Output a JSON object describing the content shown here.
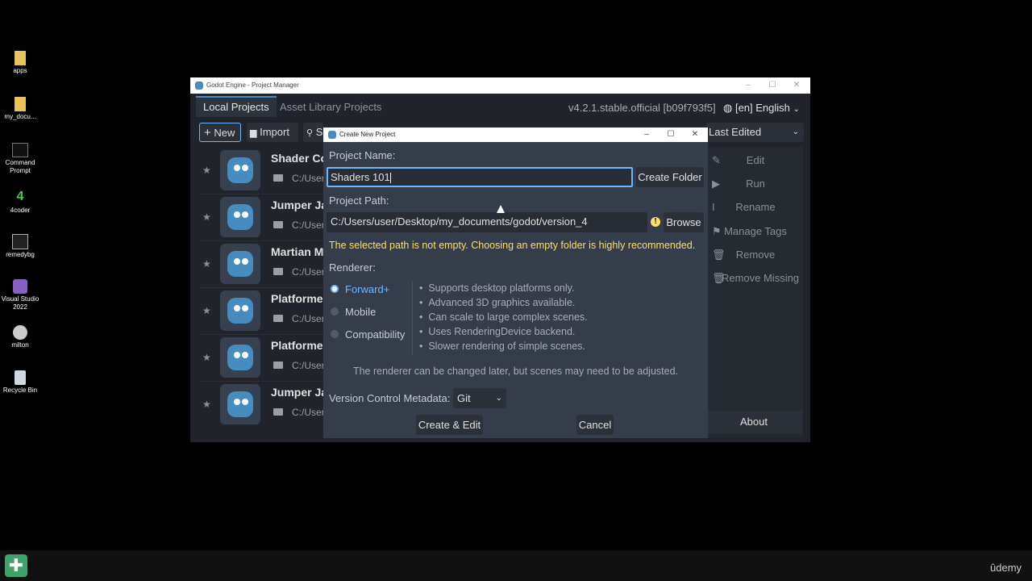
{
  "desktop": {
    "icons": [
      {
        "label": "apps",
        "icon": "folder-icon"
      },
      {
        "label": "my_docu...",
        "icon": "folder-icon"
      },
      {
        "label": "Command Prompt",
        "icon": "terminal-icon"
      },
      {
        "label": "4coder",
        "icon": "4coder-icon"
      },
      {
        "label": "remedybg",
        "icon": "remedybg-icon"
      },
      {
        "label": "Visual Studio 2022",
        "icon": "visual-studio-icon"
      },
      {
        "label": "milton",
        "icon": "milton-icon"
      },
      {
        "label": "Recycle Bin",
        "icon": "recycle-bin-icon"
      }
    ],
    "watermark": "ûdemy"
  },
  "main_window": {
    "title": "Godot Engine - Project Manager",
    "tabs": [
      "Local Projects",
      "Asset Library Projects"
    ],
    "version": "v4.2.1.stable.official [b09f793f5]",
    "language": "[en] English",
    "toolbar": {
      "new": "New",
      "import": "Import",
      "scan": "S",
      "sort": "Last Edited"
    },
    "projects": [
      {
        "name": "Shader Co",
        "path": "C:/User"
      },
      {
        "name": "Jumper Jan",
        "path": "C:/User"
      },
      {
        "name": "Martian M",
        "path": "C:/User"
      },
      {
        "name": "Platformer",
        "path": "C:/User"
      },
      {
        "name": "Platformer",
        "path": "C:/User"
      },
      {
        "name": "Jumper Jan",
        "path": "C:/User"
      }
    ],
    "side_buttons": [
      "Edit",
      "Run",
      "Rename",
      "Manage Tags",
      "Remove",
      "Remove Missing"
    ],
    "about": "About"
  },
  "dialog": {
    "title": "Create New Project",
    "project_name_label": "Project Name:",
    "project_name_value": "Shaders 101",
    "create_folder": "Create Folder",
    "project_path_label": "Project Path:",
    "project_path_value": "C:/Users/user/Desktop/my_documents/godot/version_4",
    "browse": "Browse",
    "warning": "The selected path is not empty. Choosing an empty folder is highly recommended.",
    "renderer_label": "Renderer:",
    "renderers": [
      {
        "label": "Forward+",
        "selected": true
      },
      {
        "label": "Mobile",
        "selected": false
      },
      {
        "label": "Compatibility",
        "selected": false
      }
    ],
    "features": [
      "Supports desktop platforms only.",
      "Advanced 3D graphics available.",
      "Can scale to large complex scenes.",
      "Uses RenderingDevice backend.",
      "Slower rendering of simple scenes."
    ],
    "renderer_note": "The renderer can be changed later, but scenes may need to be adjusted.",
    "vcs_label": "Version Control Metadata:",
    "vcs_value": "Git",
    "create_edit": "Create & Edit",
    "cancel": "Cancel"
  },
  "colors": {
    "accent": "#478cbf",
    "warning": "#ffde66",
    "selected_radio": "#6bb8ff"
  }
}
